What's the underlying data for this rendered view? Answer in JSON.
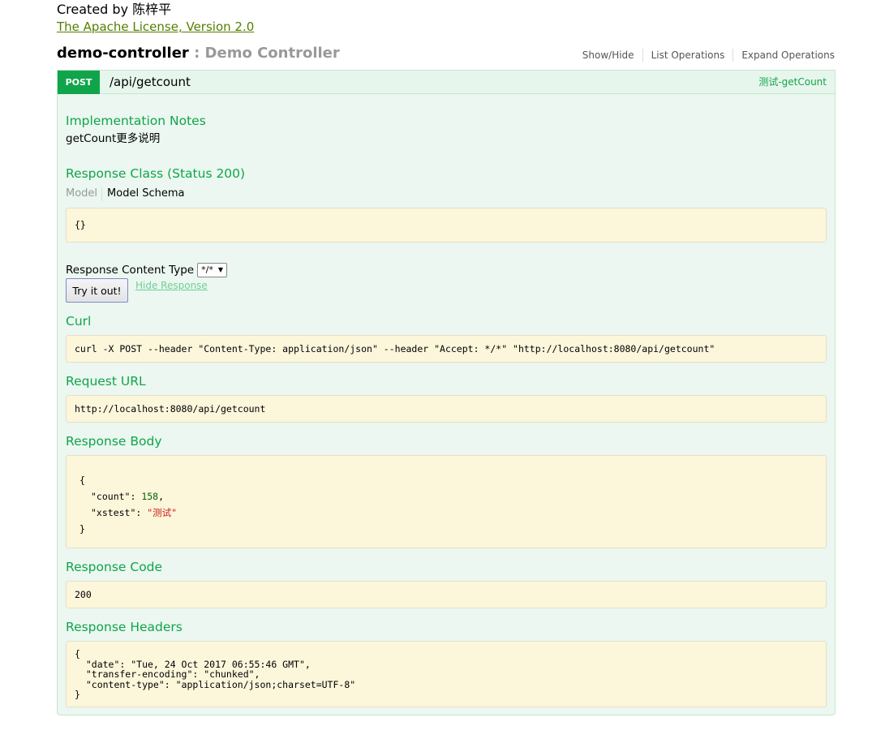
{
  "info": {
    "created_by": "Created by 陈梓平",
    "license": "The Apache License, Version 2.0"
  },
  "controller": {
    "name": "demo-controller",
    "description": " : Demo Controller",
    "ops": [
      "Show/Hide",
      "List Operations",
      "Expand Operations"
    ]
  },
  "endpoint": {
    "method": "POST",
    "path": "/api/getcount",
    "summary": "测试-getCount",
    "impl_notes_title": "Implementation Notes",
    "impl_notes": "getCount更多说明",
    "response_class_title": "Response Class (Status 200)",
    "tab_model": "Model",
    "tab_schema": "Model Schema",
    "schema": "{}",
    "response_content_type_label": "Response Content Type",
    "response_content_type_value": "*/*",
    "try_button": "Try it out!",
    "hide_response": "Hide Response"
  },
  "result": {
    "curl_title": "Curl",
    "curl": "curl -X POST --header \"Content-Type: application/json\" --header \"Accept: */*\" \"http://localhost:8080/api/getcount\"",
    "request_url_title": "Request URL",
    "request_url": "http://localhost:8080/api/getcount",
    "response_body_title": "Response Body",
    "body": {
      "open": "{",
      "count_key": "\"count\": ",
      "count_val": "158",
      "count_comma": ",",
      "xstest_key": "\"xstest\": ",
      "xstest_val": "\"测试\"",
      "close": "}"
    },
    "response_code_title": "Response Code",
    "response_code": "200",
    "response_headers_title": "Response Headers",
    "headers": [
      "{",
      "  \"date\": \"Tue, 24 Oct 2017 06:55:46 GMT\",",
      "  \"transfer-encoding\": \"chunked\",",
      "  \"content-type\": \"application/json;charset=UTF-8\"",
      "}"
    ]
  }
}
